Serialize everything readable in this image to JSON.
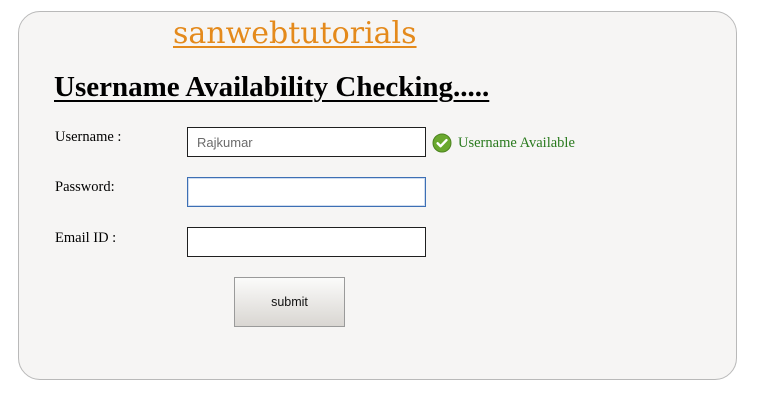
{
  "brand": {
    "name": "sanwebtutorials"
  },
  "page": {
    "title": "Username Availability Checking....."
  },
  "form": {
    "username": {
      "label": "Username :",
      "value": "Rajkumar",
      "status_text": "Username Available",
      "status_icon": "check-circle-icon",
      "status_color": "#2a7a1e"
    },
    "password": {
      "label": "Password:",
      "value": ""
    },
    "email": {
      "label": "Email ID :",
      "value": ""
    },
    "submit_label": "submit"
  },
  "colors": {
    "brand": "#e48a1c",
    "panel_background": "#f6f5f4",
    "focus_border": "#3d6fb4"
  }
}
